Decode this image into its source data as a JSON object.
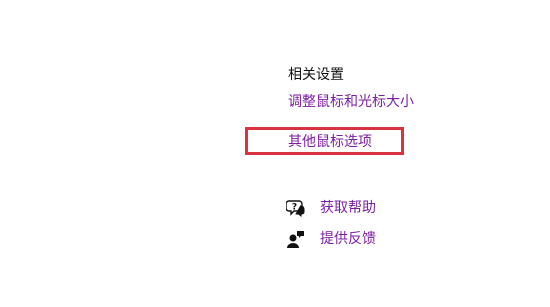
{
  "related_settings": {
    "title": "相关设置",
    "links": {
      "pointer_size": "调整鼠标和光标大小",
      "other_mouse_options": "其他鼠标选项"
    }
  },
  "help": {
    "get_help": {
      "label": "获取帮助",
      "icon": "chat-help-icon"
    },
    "feedback": {
      "label": "提供反馈",
      "icon": "feedback-person-icon"
    }
  },
  "colors": {
    "link": "#7a1fa2",
    "highlight": "#d9333f",
    "text": "#111111"
  }
}
